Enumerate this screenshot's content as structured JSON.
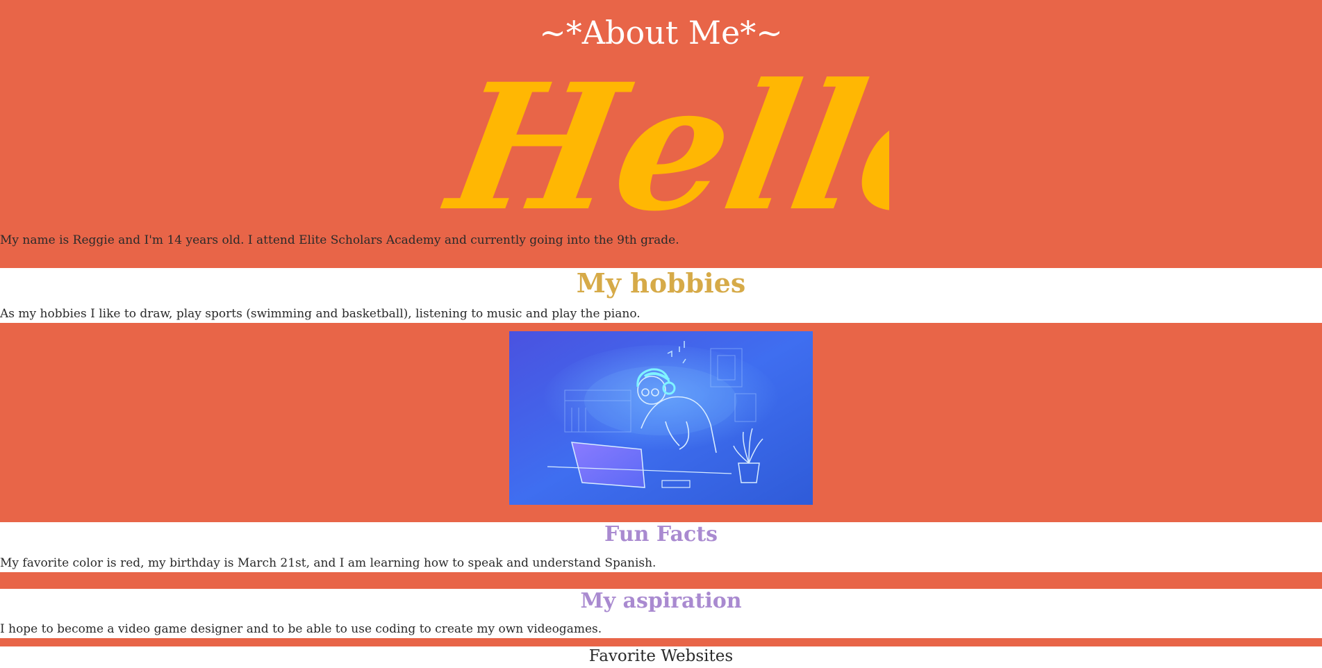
{
  "header": {
    "title": "~*About Me*~",
    "hello_art_text": "Hello",
    "intro": "My name is Reggie and I'm 14 years old. I attend Elite Scholars Academy and currently going into the 9th grade."
  },
  "hobbies": {
    "heading": "My hobbies",
    "text": "As my hobbies I like to draw, play sports (swimming and basketball), listening to music and play the piano."
  },
  "fun_facts": {
    "heading": "Fun Facts",
    "text": "My favorite color is red, my birthday is March 21st, and I am learning how to speak and understand Spanish."
  },
  "aspiration": {
    "heading": "My aspiration",
    "text": "I hope to become a video game designer and to be able to use coding to create my own videogames."
  },
  "websites": {
    "heading": "Favorite Websites"
  },
  "colors": {
    "background": "#e86548",
    "hello": "#ffb703",
    "hobbies_heading": "#d6aa48",
    "purple_heading": "#a98ad0"
  }
}
